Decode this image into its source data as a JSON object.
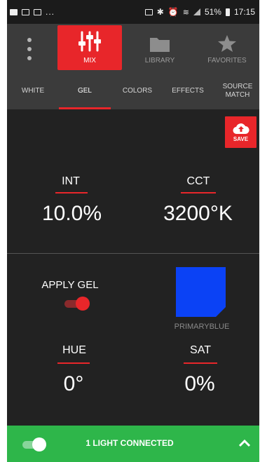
{
  "status_bar": {
    "left_dots": "...",
    "battery": "51%",
    "time": "17:15"
  },
  "nav": {
    "mix": "MIX",
    "library": "LIBRARY",
    "favorites": "FAVORITES"
  },
  "sub_tabs": [
    "WHITE",
    "GEL",
    "COLORS",
    "EFFECTS",
    "SOURCE\nMATCH"
  ],
  "save_label": "SAVE",
  "intensity": {
    "label": "INT",
    "value": "10.0%"
  },
  "cct": {
    "label": "CCT",
    "value": "3200°K"
  },
  "apply_gel": {
    "label": "APPLY GEL",
    "on": true
  },
  "gel": {
    "name": "PRIMARYBLUE",
    "color": "#0b42f5"
  },
  "hue": {
    "label": "HUE",
    "value": "0°"
  },
  "sat": {
    "label": "SAT",
    "value": "0%"
  },
  "connection": {
    "text": "1 LIGHT CONNECTED",
    "on": true
  },
  "colors": {
    "accent": "#e8262a",
    "bar": "#2eb64a",
    "background": "#222222"
  }
}
